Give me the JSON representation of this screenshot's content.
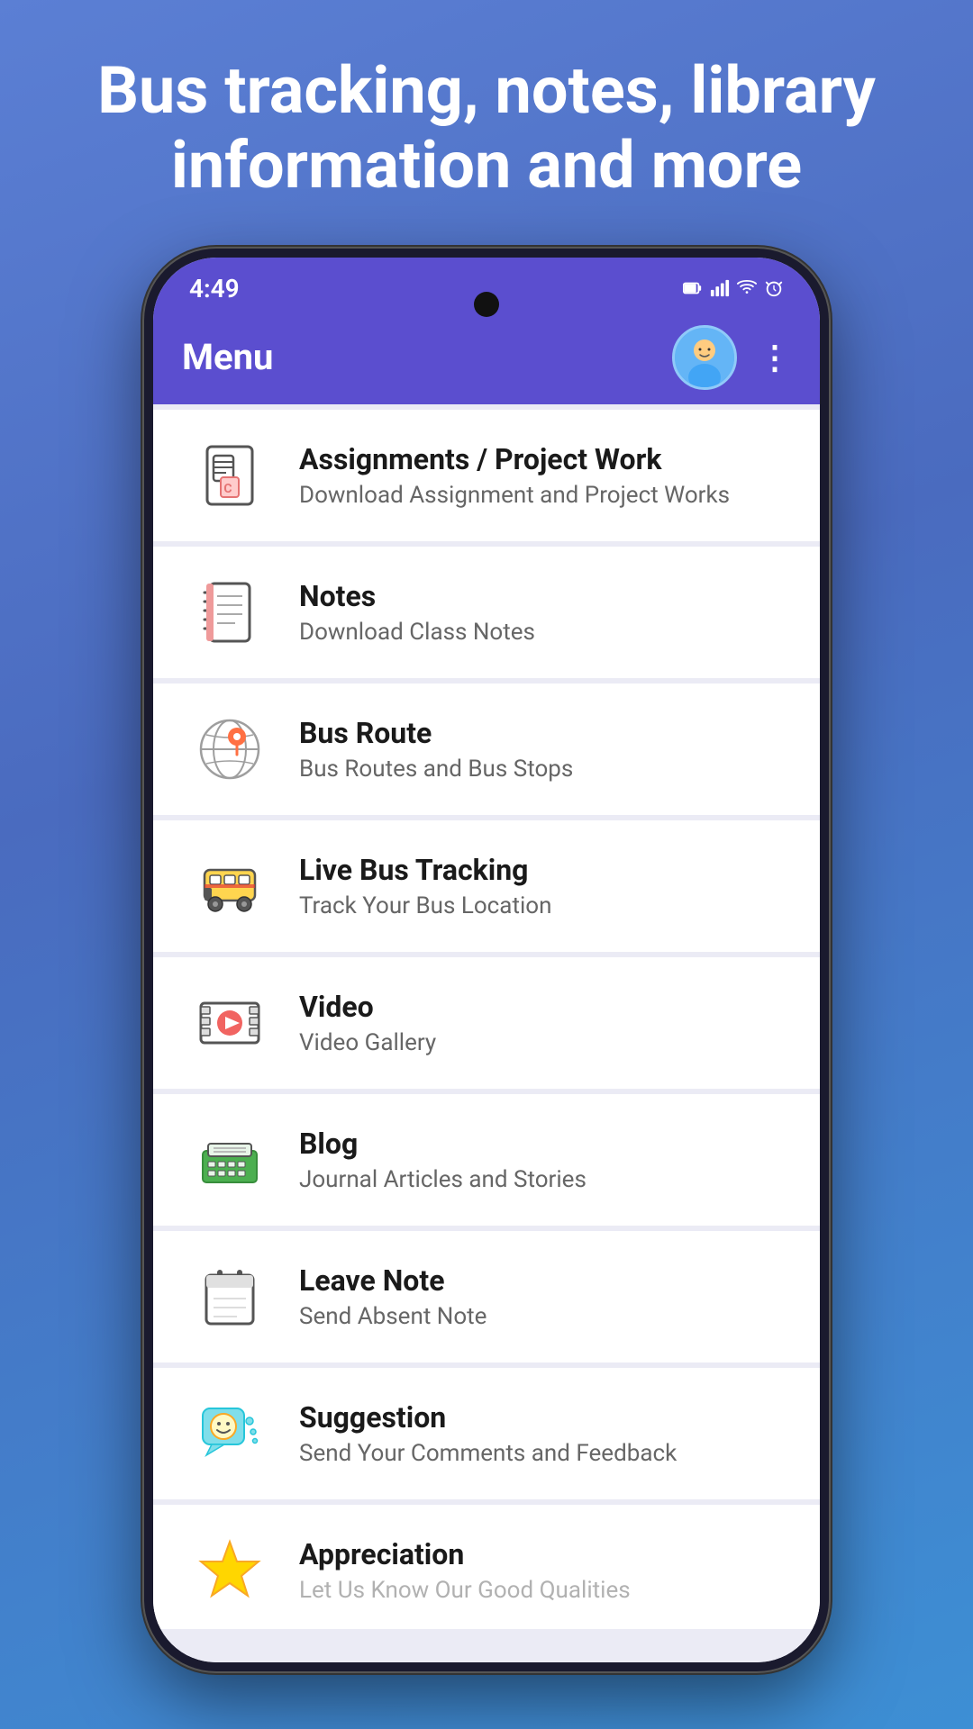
{
  "hero": {
    "title": "Bus tracking, notes, library information and more"
  },
  "statusBar": {
    "time": "4:49",
    "icons": [
      "🔋",
      "📶",
      "🔔"
    ]
  },
  "appBar": {
    "title": "Menu",
    "moreIcon": "⋮"
  },
  "menuItems": [
    {
      "id": "assignments",
      "title": "Assignments / Project Work",
      "subtitle": "Download Assignment and Project Works",
      "iconType": "assignments"
    },
    {
      "id": "notes",
      "title": "Notes",
      "subtitle": "Download Class Notes",
      "iconType": "notes"
    },
    {
      "id": "bus-route",
      "title": "Bus Route",
      "subtitle": "Bus Routes and Bus Stops",
      "iconType": "bus-route"
    },
    {
      "id": "live-bus",
      "title": "Live Bus Tracking",
      "subtitle": "Track Your Bus Location",
      "iconType": "live-bus"
    },
    {
      "id": "video",
      "title": "Video",
      "subtitle": "Video Gallery",
      "iconType": "video"
    },
    {
      "id": "blog",
      "title": "Blog",
      "subtitle": "Journal Articles and Stories",
      "iconType": "blog"
    },
    {
      "id": "leave-note",
      "title": "Leave Note",
      "subtitle": "Send Absent Note",
      "iconType": "leave-note"
    },
    {
      "id": "suggestion",
      "title": "Suggestion",
      "subtitle": "Send Your Comments and Feedback",
      "iconType": "suggestion"
    },
    {
      "id": "appreciation",
      "title": "Appreciation",
      "subtitle": "Let Us Know Our Good Qualities",
      "iconType": "appreciation"
    }
  ]
}
